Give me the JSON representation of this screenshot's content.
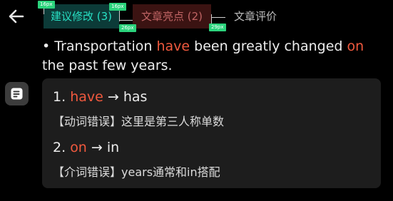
{
  "tabs": [
    {
      "label": "建议修改 (3)",
      "active": true
    },
    {
      "label": "文章亮点 (2)",
      "active": false
    },
    {
      "label": "文章评价",
      "active": false
    }
  ],
  "measure_labels": [
    "16px",
    "16px",
    "26px",
    "29px"
  ],
  "sentence": {
    "bullet": "•",
    "p1": " Transportation ",
    "hl1": "have",
    "p2": " been greatly changed ",
    "hl2": "on",
    "p3": " the past few years."
  },
  "corrections": [
    {
      "number": "1.",
      "wrong": "have",
      "arrow": "→",
      "right": "has",
      "explanation": "【动词错误】这里是第三人称单数"
    },
    {
      "number": "2.",
      "wrong": "on",
      "arrow": "→",
      "right": "in",
      "explanation": "【介词错误】years通常和in搭配"
    }
  ],
  "colors": {
    "background": "#000000",
    "accent_teal": "#28e0c4",
    "highlight_red": "#f0593e",
    "card_bg": "#1d1d1d",
    "measure_chip": "#2bd37c"
  },
  "icons": [
    "back-arrow-icon",
    "document-icon"
  ]
}
